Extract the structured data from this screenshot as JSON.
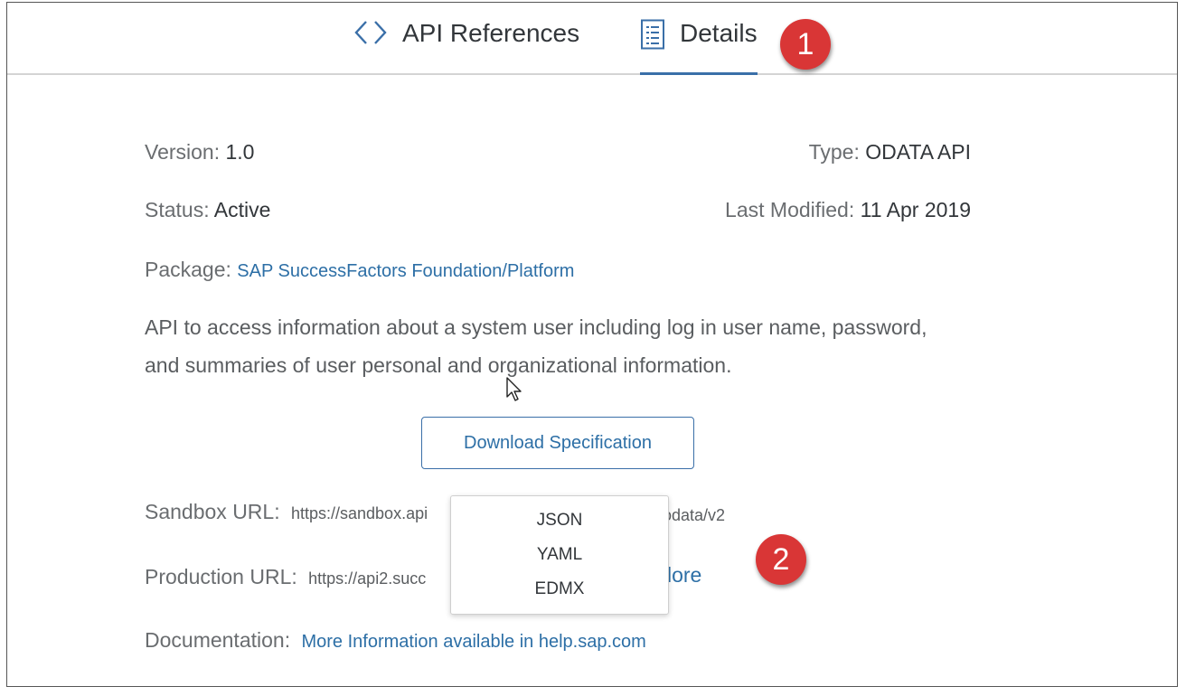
{
  "tabs": [
    {
      "label": "API References",
      "icon": "code-brackets-icon",
      "selected": false
    },
    {
      "label": "Details",
      "icon": "document-list-icon",
      "selected": true
    }
  ],
  "callouts": {
    "one": "1",
    "two": "2"
  },
  "details": {
    "version_label": "Version:",
    "version_value": "1.0",
    "type_label": "Type:",
    "type_value": "ODATA API",
    "status_label": "Status:",
    "status_value": "Active",
    "modified_label": "Last Modified:",
    "modified_value": "11 Apr 2019",
    "package_label": "Package:",
    "package_value": "SAP SuccessFactors Foundation/Platform",
    "description_line1": "API to access information about a system user including log in user name, password,",
    "description_line2": "and summaries of user personal and organizational information.",
    "download_button": "Download Specification",
    "sandbox_label": "Sandbox URL:",
    "sandbox_value_start": "https://sandbox.api",
    "sandbox_value_end": "odata/v2",
    "production_label": "Production URL:",
    "production_value_start": "https://api2.succ",
    "production_more": "lore",
    "documentation_label": "Documentation:",
    "documentation_link": "More Information available in help.sap.com"
  },
  "download_menu": {
    "options": [
      "JSON",
      "YAML",
      "EDMX"
    ]
  },
  "colors": {
    "accent": "#3a6fa8",
    "link": "#2d6fa6",
    "callout": "#d93636"
  }
}
